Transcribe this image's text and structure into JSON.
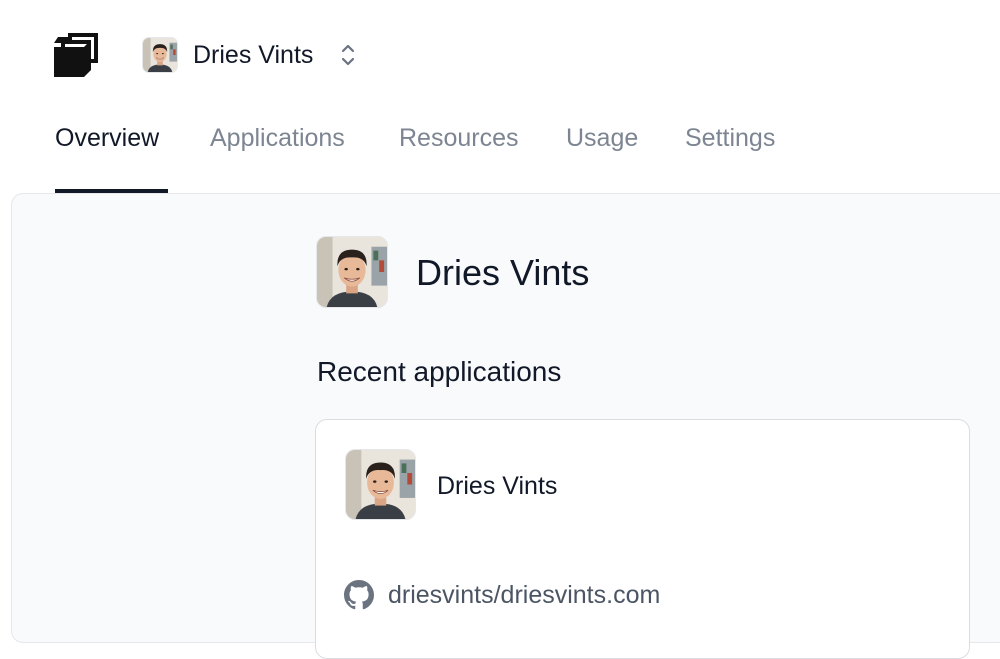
{
  "header": {
    "logo_icon": "stacked-squares-logo-icon",
    "org_switcher": {
      "name": "Dries Vints",
      "avatar_icon": "user-avatar",
      "chevron_icon": "chevron-up-down-icon"
    }
  },
  "tabs": [
    {
      "label": "Overview",
      "active": true
    },
    {
      "label": "Applications",
      "active": false
    },
    {
      "label": "Resources",
      "active": false
    },
    {
      "label": "Usage",
      "active": false
    },
    {
      "label": "Settings",
      "active": false
    }
  ],
  "main": {
    "profile": {
      "name": "Dries Vints",
      "avatar_icon": "user-avatar"
    },
    "recent_applications": {
      "title": "Recent applications",
      "items": [
        {
          "name": "Dries Vints",
          "repo": "driesvints/driesvints.com",
          "repo_icon": "github-icon"
        }
      ]
    }
  },
  "colors": {
    "text_primary": "#111827",
    "text_muted": "#7c8591",
    "panel_bg": "#f9fafb",
    "border": "#e5e7eb"
  }
}
